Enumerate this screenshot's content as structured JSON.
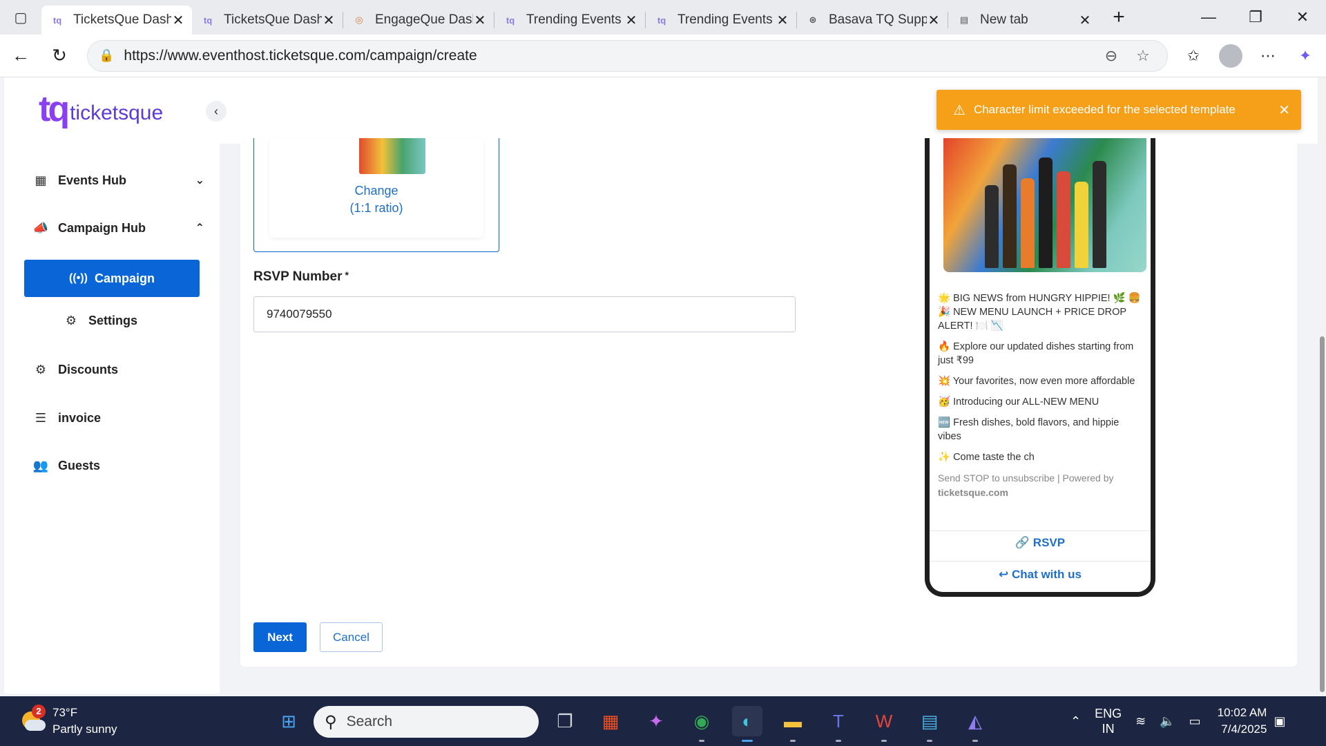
{
  "browser": {
    "tabs": [
      {
        "title": "TicketsQue Dashb",
        "active": true
      },
      {
        "title": "TicketsQue Dashb",
        "active": false
      },
      {
        "title": "EngageQue Dashb",
        "active": false
      },
      {
        "title": "Trending Events",
        "active": false
      },
      {
        "title": "Trending Events",
        "active": false
      },
      {
        "title": "Basava TQ Suppo",
        "active": false
      },
      {
        "title": "New tab",
        "active": false
      }
    ],
    "url": "https://www.eventhost.ticketsque.com/campaign/create"
  },
  "sidebar": {
    "logo_mark": "tq",
    "logo_text": "ticketsque",
    "items": [
      {
        "label": "Events Hub"
      },
      {
        "label": "Campaign Hub"
      },
      {
        "label": "Campaign"
      },
      {
        "label": "Settings"
      },
      {
        "label": "Discounts"
      },
      {
        "label": "invoice"
      },
      {
        "label": "Guests"
      }
    ]
  },
  "form": {
    "image_change_label": "Change",
    "image_ratio_label": "(1:1 ratio)",
    "rsvp_label": "RSVP Number",
    "rsvp_required_mark": "*",
    "rsvp_value": "9740079550",
    "next_label": "Next",
    "cancel_label": "Cancel"
  },
  "preview": {
    "lines": [
      "🌟 BIG NEWS from HUNGRY HIPPIE! 🌿 🍔 🎉 NEW MENU LAUNCH + PRICE DROP ALERT! 🍽️ 📉",
      "🔥 Explore our updated dishes starting from just ₹99",
      "💥 Your favorites, now even more affordable",
      "🥳 Introducing our ALL-NEW MENU",
      "🆕 Fresh dishes, bold flavors, and hippie vibes",
      "✨ Come taste the ch"
    ],
    "footer_text": "Send STOP to unsubscribe | Powered by",
    "footer_brand": "ticketsque.com",
    "rsvp_action": "RSVP",
    "chat_action": "Chat with us"
  },
  "toast": {
    "message": "Character limit exceeded for the selected template",
    "color": "#f6a019"
  },
  "taskbar": {
    "weather_temp": "73°F",
    "weather_desc": "Partly sunny",
    "weather_badge": "2",
    "search_placeholder": "Search",
    "lang_line1": "ENG",
    "lang_line2": "IN",
    "time": "10:02 AM",
    "date": "7/4/2025"
  },
  "colors": {
    "primary": "#0a66d6",
    "link": "#1e6fc9",
    "warning": "#f6a019",
    "taskbar": "#1c2541"
  }
}
